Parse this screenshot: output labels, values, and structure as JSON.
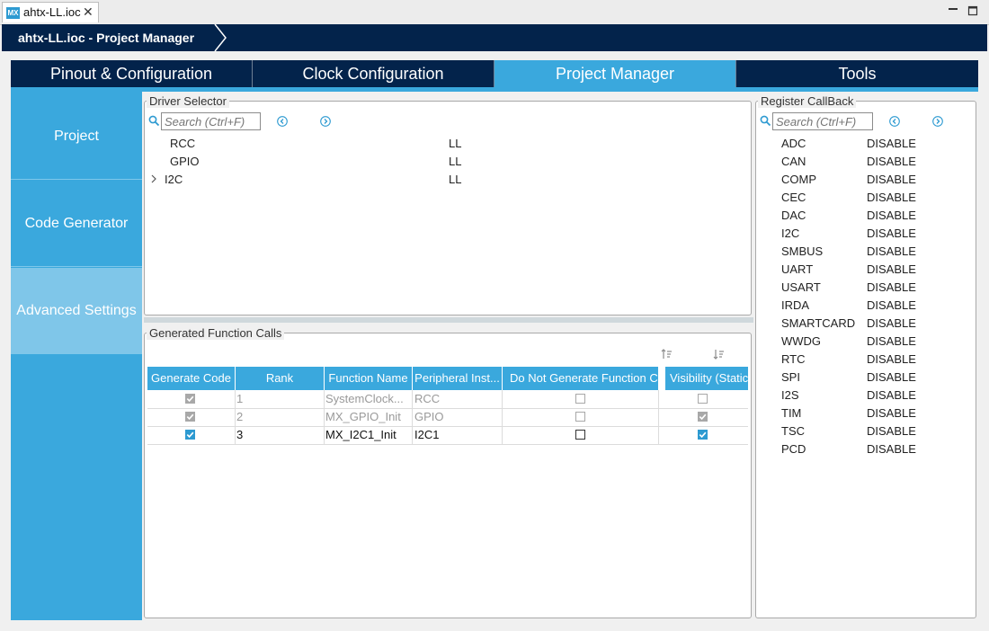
{
  "window": {
    "tab_label": "ahtx-LL.ioc",
    "app_badge": "MX"
  },
  "breadcrumb": {
    "label": "ahtx-LL.ioc - Project Manager"
  },
  "top_tabs": [
    {
      "label": "Pinout & Configuration",
      "active": false
    },
    {
      "label": "Clock Configuration",
      "active": false
    },
    {
      "label": "Project Manager",
      "active": true
    },
    {
      "label": "Tools",
      "active": false
    }
  ],
  "left_nav": [
    {
      "label": "Project",
      "active": false
    },
    {
      "label": "Code Generator",
      "active": false
    },
    {
      "label": "Advanced Settings",
      "active": true
    }
  ],
  "driver_selector": {
    "title": "Driver Selector",
    "search_placeholder": "Search (Ctrl+F)",
    "rows": [
      {
        "name": "RCC",
        "driver": "LL",
        "expandable": false
      },
      {
        "name": "GPIO",
        "driver": "LL",
        "expandable": false
      },
      {
        "name": "I2C",
        "driver": "LL",
        "expandable": true
      }
    ]
  },
  "generated_calls": {
    "title": "Generated Function Calls",
    "columns": [
      "Generate Code",
      "Rank",
      "Function Name",
      "Peripheral Inst...",
      "Do Not Generate Function C",
      "Visibility (Static)"
    ],
    "rows": [
      {
        "generate": true,
        "rank": "1",
        "function": "SystemClock...",
        "peripheral": "RCC",
        "do_not_generate": false,
        "visibility": false,
        "enabled": false
      },
      {
        "generate": true,
        "rank": "2",
        "function": "MX_GPIO_Init",
        "peripheral": "GPIO",
        "do_not_generate": false,
        "visibility": true,
        "enabled": false
      },
      {
        "generate": true,
        "rank": "3",
        "function": "MX_I2C1_Init",
        "peripheral": "I2C1",
        "do_not_generate": false,
        "visibility": true,
        "enabled": true
      }
    ]
  },
  "register_callback": {
    "title": "Register CallBack",
    "search_placeholder": "Search (Ctrl+F)",
    "rows": [
      {
        "name": "ADC",
        "value": "DISABLE"
      },
      {
        "name": "CAN",
        "value": "DISABLE"
      },
      {
        "name": "COMP",
        "value": "DISABLE"
      },
      {
        "name": "CEC",
        "value": "DISABLE"
      },
      {
        "name": "DAC",
        "value": "DISABLE"
      },
      {
        "name": "I2C",
        "value": "DISABLE"
      },
      {
        "name": "SMBUS",
        "value": "DISABLE"
      },
      {
        "name": "UART",
        "value": "DISABLE"
      },
      {
        "name": "USART",
        "value": "DISABLE"
      },
      {
        "name": "IRDA",
        "value": "DISABLE"
      },
      {
        "name": "SMARTCARD",
        "value": "DISABLE"
      },
      {
        "name": "WWDG",
        "value": "DISABLE"
      },
      {
        "name": "RTC",
        "value": "DISABLE"
      },
      {
        "name": "SPI",
        "value": "DISABLE"
      },
      {
        "name": "I2S",
        "value": "DISABLE"
      },
      {
        "name": "TIM",
        "value": "DISABLE"
      },
      {
        "name": "TSC",
        "value": "DISABLE"
      },
      {
        "name": "PCD",
        "value": "DISABLE"
      }
    ]
  },
  "colors": {
    "navy": "#03234b",
    "accent": "#3aa8dd",
    "nav_active": "#7fc6e9",
    "check_enabled": "#2d9ad1",
    "check_disabled": "#9a9a9a"
  }
}
